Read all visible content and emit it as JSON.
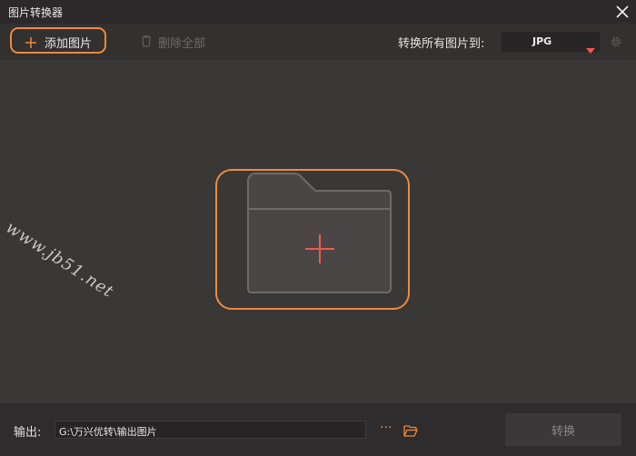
{
  "window": {
    "title": "图片转换器"
  },
  "toolbar": {
    "add_label": "添加图片",
    "delete_all_label": "删除全部",
    "convert_all_label": "转换所有图片到:",
    "format_value": "JPG"
  },
  "watermark": {
    "text": "www.jb51.net"
  },
  "output": {
    "label": "输出:",
    "path": "G:\\万兴优转\\输出图片",
    "more": "···"
  },
  "convert_button": {
    "label": "转换"
  },
  "colors": {
    "accent": "#f08a3c",
    "plus_red": "#f0584e",
    "background": "#3a3737"
  }
}
